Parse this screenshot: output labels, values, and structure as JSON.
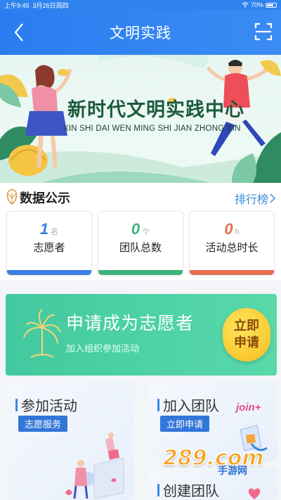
{
  "status_bar": {
    "time": "上午9:45",
    "date": "3月26日周四",
    "battery": "70%"
  },
  "nav": {
    "title": "文明实践"
  },
  "banner": {
    "title": "新时代文明实践中心",
    "subtitle": "XIN SHI DAI WEN MING SHI JIAN ZHONG XIN"
  },
  "data_section": {
    "title": "数据公示",
    "rank_label": "排行榜"
  },
  "stats": [
    {
      "value": "1",
      "unit": "名",
      "label": "志愿者",
      "color": "#3d7fe0"
    },
    {
      "value": "0",
      "unit": "个",
      "label": "团队总数",
      "color": "#3db47f"
    },
    {
      "value": "0",
      "unit": "h",
      "label": "活动总时长",
      "color": "#e3704f"
    }
  ],
  "apply": {
    "title": "申请成为志愿者",
    "subtitle": "加入组织参加活动",
    "button_line1": "立即",
    "button_line2": "申请"
  },
  "cards": {
    "join_activity": {
      "title": "参加活动",
      "tag": "志愿服务"
    },
    "join_team": {
      "title": "加入团队",
      "tag": "立即申请",
      "decor": "join+"
    },
    "create_team": {
      "title": "创建团队"
    }
  },
  "watermark": {
    "text": "289.com",
    "sub": "手游网"
  }
}
